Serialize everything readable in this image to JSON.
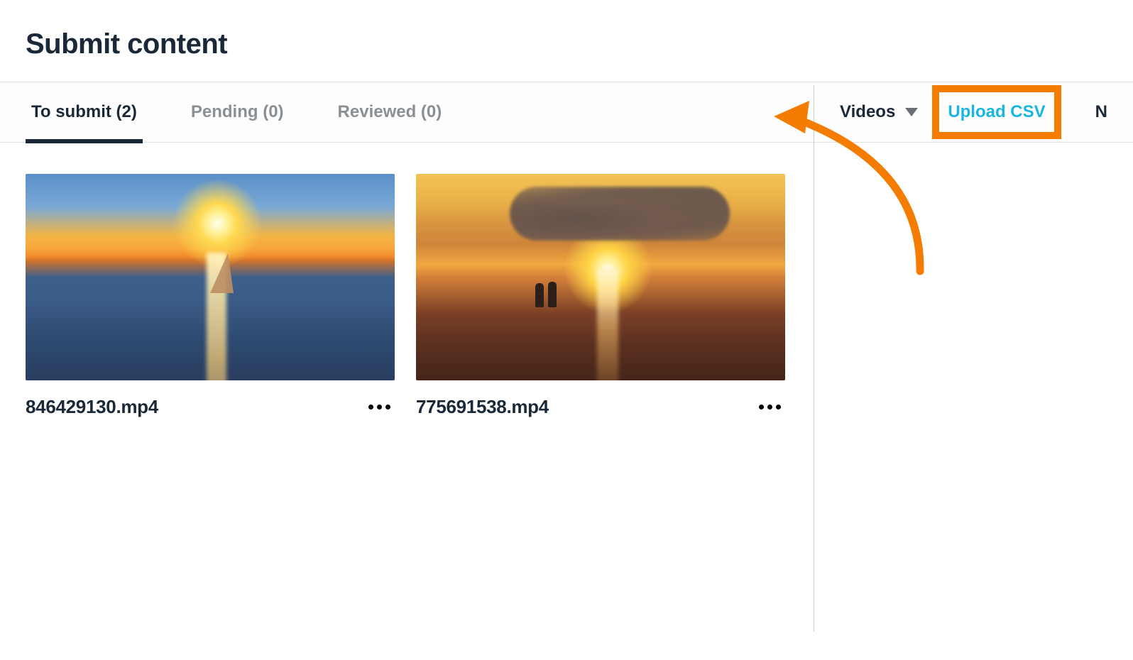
{
  "page": {
    "title": "Submit content"
  },
  "tabs": {
    "to_submit": "To submit (2)",
    "pending": "Pending (0)",
    "reviewed": "Reviewed (0)"
  },
  "toolbar": {
    "filter_label": "Videos",
    "upload_csv": "Upload CSV",
    "truncated": "N"
  },
  "videos": [
    {
      "filename": "846429130.mp4"
    },
    {
      "filename": "775691538.mp4"
    }
  ],
  "annotation": {
    "highlight_target": "upload-csv",
    "arrow_color": "#f47c00"
  }
}
